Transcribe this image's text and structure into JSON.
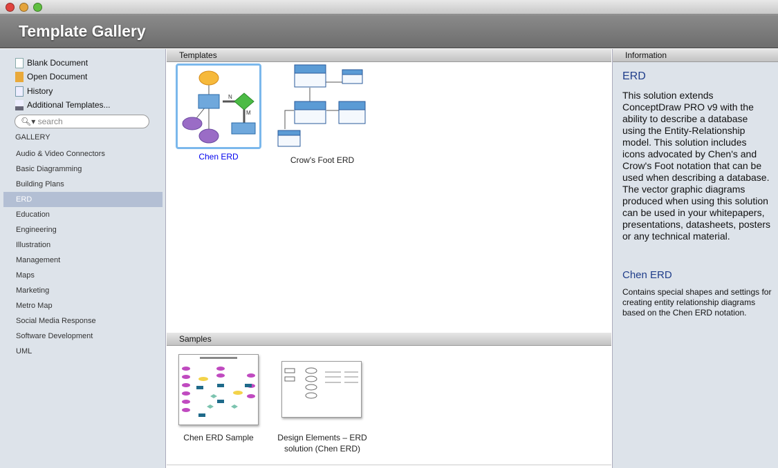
{
  "window": {
    "title": "Template Gallery"
  },
  "actions": [
    {
      "label": "Blank Document",
      "icon": "blank-document-icon"
    },
    {
      "label": "Open Document",
      "icon": "folder-icon"
    },
    {
      "label": "History",
      "icon": "history-icon"
    },
    {
      "label": "Additional Templates...",
      "icon": "download-icon"
    }
  ],
  "search": {
    "placeholder": "search"
  },
  "gallery": {
    "heading": "GALLERY",
    "items": [
      "Audio & Video Connectors",
      "Basic Diagramming",
      "Building Plans",
      "ERD",
      "Education",
      "Engineering",
      "Illustration",
      "Management",
      "Maps",
      "Marketing",
      "Metro Map",
      "Social Media Response",
      "Software Development",
      "UML"
    ],
    "selected": "ERD"
  },
  "templates": {
    "heading": "Templates",
    "items": [
      {
        "label": "Chen ERD",
        "selected": true
      },
      {
        "label": "Crow's Foot ERD"
      }
    ],
    "n_label": "N",
    "m_label": "M"
  },
  "samples": {
    "heading": "Samples",
    "items": [
      {
        "label": "Chen ERD Sample"
      },
      {
        "label": "Design Elements – ERD solution (Chen ERD)"
      }
    ]
  },
  "information": {
    "heading": "Information",
    "title": "ERD",
    "body": "This solution extends ConceptDraw PRO v9 with the ability to describe a database using the Entity-Relationship model. This solution includes icons advocated by Chen's and Crow's Foot notation that can be used when describing a database. The vector graphic diagrams produced when using this solution can be used in your whitepapers, presentations, datasheets, posters or any technical material.",
    "sub_title": "Chen ERD",
    "sub_body": "Contains special shapes and settings for creating entity relationship diagrams based on the Chen ERD notation."
  },
  "colors": {
    "selected_label": "#0000ee",
    "info_heading": "#1f3d8a"
  }
}
